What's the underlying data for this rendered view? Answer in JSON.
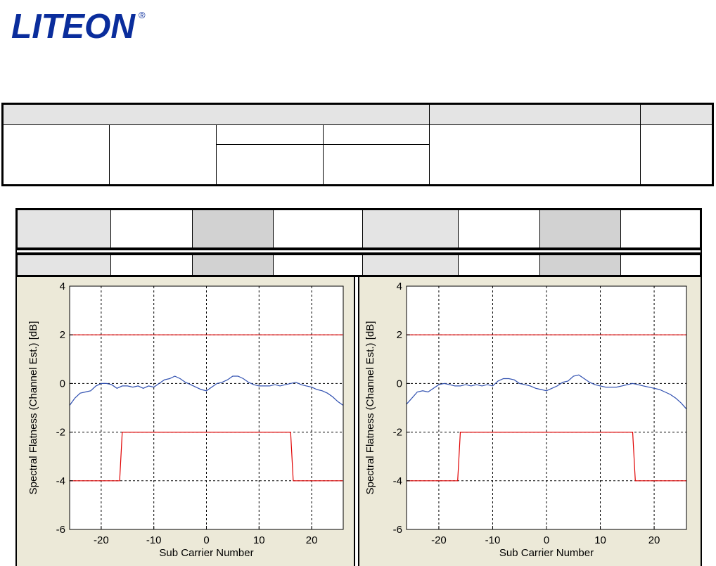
{
  "logo": {
    "text": "LITEON",
    "mark": "®",
    "color": "#0a2d9c"
  },
  "colors": {
    "limit": "#e00000",
    "trace": "#3050b0",
    "panel_bg": "#ece9d8",
    "header_shade": "#e4e4e4"
  },
  "chart_data": [
    {
      "type": "line",
      "xlabel": "Sub Carrier Number",
      "ylabel": "Spectral Flatness (Channel Est.) [dB]",
      "xlim": [
        -26,
        26
      ],
      "ylim": [
        -6,
        4
      ],
      "x_ticks": [
        -20,
        -10,
        0,
        10,
        20
      ],
      "y_ticks": [
        4,
        2,
        0,
        -2,
        -4,
        -6
      ],
      "grid": true,
      "series": [
        {
          "role": "upper-limit",
          "x": [
            -26,
            26
          ],
          "y": [
            2,
            2
          ]
        },
        {
          "role": "lower-limit",
          "x": [
            -26,
            -16.5,
            -16,
            16,
            16.5,
            26
          ],
          "y": [
            -4,
            -4,
            -2,
            -2,
            -4,
            -4
          ]
        },
        {
          "role": "measured",
          "x": [
            -26,
            -25,
            -24,
            -23,
            -22,
            -21,
            -20,
            -19,
            -18,
            -17,
            -16,
            -15,
            -14,
            -13,
            -12,
            -11,
            -10,
            -9,
            -8,
            -7,
            -6,
            -5,
            -4,
            -3,
            -2,
            -1,
            0,
            1,
            2,
            3,
            4,
            5,
            6,
            7,
            8,
            9,
            10,
            11,
            12,
            13,
            14,
            15,
            16,
            17,
            18,
            19,
            20,
            21,
            22,
            23,
            24,
            25,
            26
          ],
          "y": [
            -0.9,
            -0.6,
            -0.4,
            -0.35,
            -0.3,
            -0.1,
            0.0,
            0.0,
            -0.05,
            -0.2,
            -0.1,
            -0.1,
            -0.15,
            -0.1,
            -0.2,
            -0.1,
            -0.15,
            0.0,
            0.15,
            0.2,
            0.3,
            0.2,
            0.05,
            -0.05,
            -0.15,
            -0.25,
            -0.3,
            -0.15,
            0.0,
            0.05,
            0.15,
            0.3,
            0.3,
            0.2,
            0.05,
            -0.05,
            -0.1,
            -0.1,
            -0.1,
            -0.05,
            -0.1,
            -0.05,
            0.0,
            0.05,
            -0.05,
            -0.1,
            -0.15,
            -0.25,
            -0.3,
            -0.4,
            -0.55,
            -0.75,
            -0.9
          ]
        }
      ]
    },
    {
      "type": "line",
      "xlabel": "Sub Carrier Number",
      "ylabel": "Spectral Flatness (Channel Est.) [dB]",
      "xlim": [
        -26,
        26
      ],
      "ylim": [
        -6,
        4
      ],
      "x_ticks": [
        -20,
        -10,
        0,
        10,
        20
      ],
      "y_ticks": [
        4,
        2,
        0,
        -2,
        -4,
        -6
      ],
      "grid": true,
      "series": [
        {
          "role": "upper-limit",
          "x": [
            -26,
            26
          ],
          "y": [
            2,
            2
          ]
        },
        {
          "role": "lower-limit",
          "x": [
            -26,
            -16.5,
            -16,
            16,
            16.5,
            26
          ],
          "y": [
            -4,
            -4,
            -2,
            -2,
            -4,
            -4
          ]
        },
        {
          "role": "measured",
          "x": [
            -26,
            -25,
            -24,
            -23,
            -22,
            -21,
            -20,
            -19,
            -18,
            -17,
            -16,
            -15,
            -14,
            -13,
            -12,
            -11,
            -10,
            -9,
            -8,
            -7,
            -6,
            -5,
            -4,
            -3,
            -2,
            -1,
            0,
            1,
            2,
            3,
            4,
            5,
            6,
            7,
            8,
            9,
            10,
            11,
            12,
            13,
            14,
            15,
            16,
            17,
            18,
            19,
            20,
            21,
            22,
            23,
            24,
            25,
            26
          ],
          "y": [
            -0.85,
            -0.6,
            -0.35,
            -0.3,
            -0.35,
            -0.2,
            -0.05,
            0.0,
            -0.05,
            -0.1,
            -0.1,
            -0.05,
            -0.1,
            -0.05,
            -0.1,
            -0.05,
            -0.1,
            0.1,
            0.2,
            0.2,
            0.15,
            0.0,
            -0.05,
            -0.1,
            -0.2,
            -0.25,
            -0.3,
            -0.2,
            -0.1,
            0.05,
            0.1,
            0.3,
            0.35,
            0.2,
            0.05,
            -0.05,
            -0.1,
            -0.15,
            -0.15,
            -0.15,
            -0.1,
            -0.05,
            0.0,
            -0.05,
            -0.1,
            -0.15,
            -0.2,
            -0.25,
            -0.35,
            -0.45,
            -0.6,
            -0.8,
            -1.05
          ]
        }
      ]
    }
  ]
}
